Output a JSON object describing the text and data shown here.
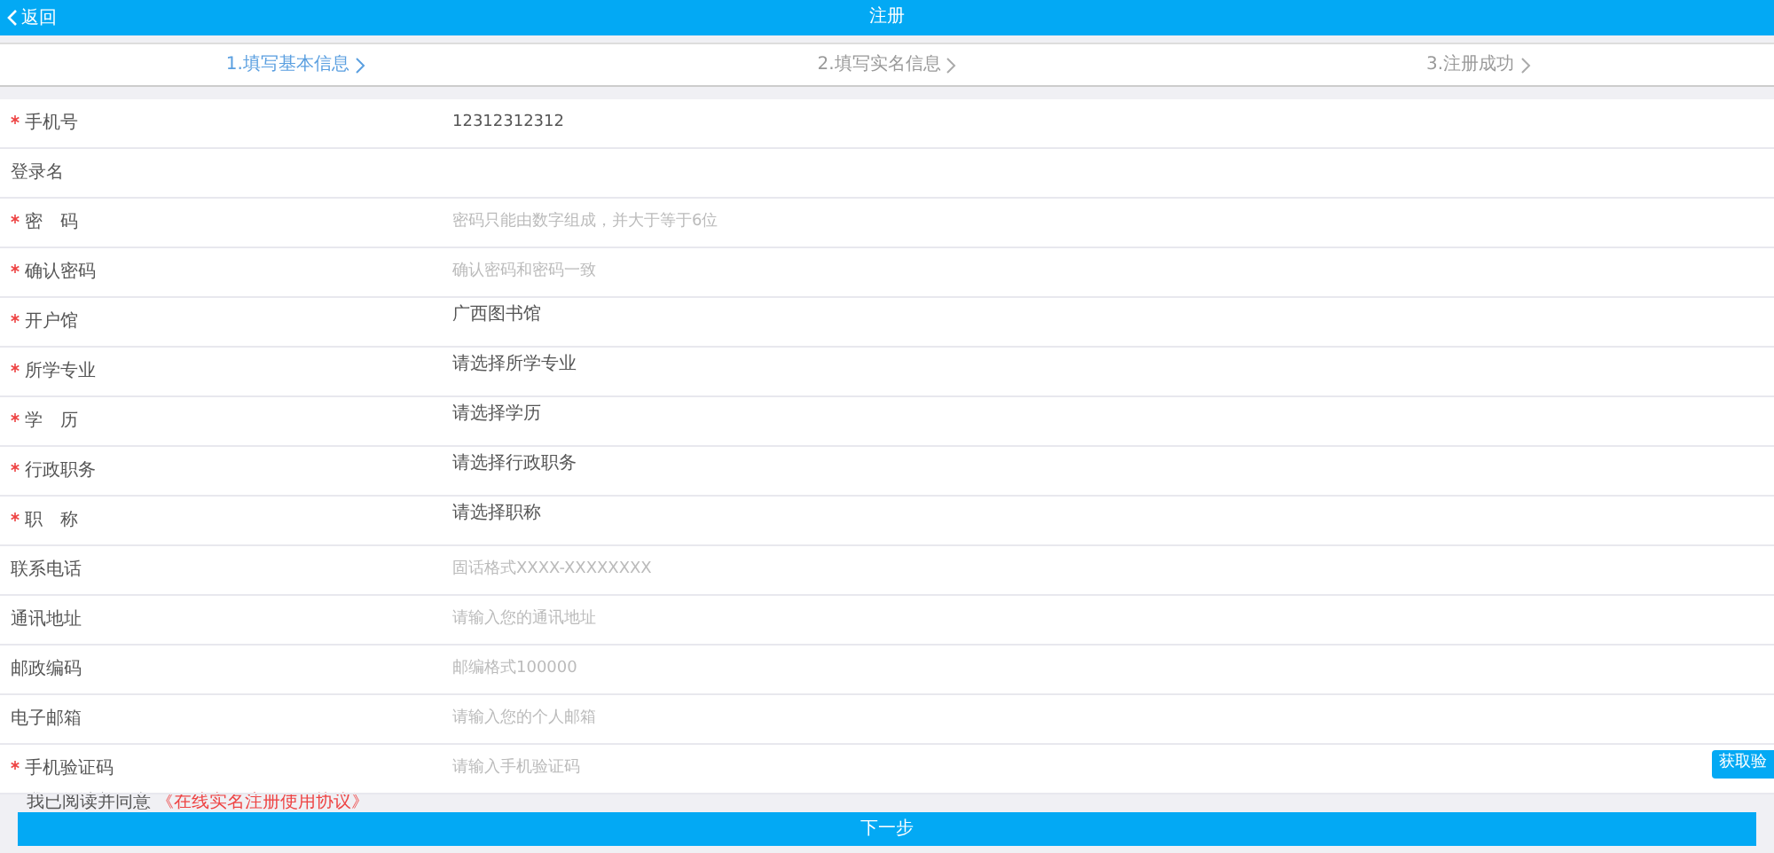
{
  "header": {
    "back": "返回",
    "title": "注册"
  },
  "steps": [
    {
      "label": "1.填写基本信息",
      "selected": true
    },
    {
      "label": "2.填写实名信息",
      "selected": false
    },
    {
      "label": "3.注册成功",
      "selected": false
    }
  ],
  "fields": [
    {
      "label": "手机号",
      "required": true,
      "kind": "input",
      "value": "12312312312"
    },
    {
      "label": "登录名",
      "required": false,
      "kind": "input"
    },
    {
      "label": "密　码",
      "required": true,
      "kind": "input",
      "placeholder": "密码只能由数字组成，并大于等于6位"
    },
    {
      "label": "确认密码",
      "required": true,
      "kind": "input",
      "placeholder": "确认密码和密码一致"
    },
    {
      "label": "开户馆",
      "required": true,
      "kind": "select",
      "value": "广西图书馆"
    },
    {
      "label": "所学专业",
      "required": true,
      "kind": "select",
      "value": "请选择所学专业"
    },
    {
      "label": "学　历",
      "required": true,
      "kind": "select",
      "value": "请选择学历"
    },
    {
      "label": "行政职务",
      "required": true,
      "kind": "select",
      "value": "请选择行政职务"
    },
    {
      "label": "职　称",
      "required": true,
      "kind": "select",
      "value": "请选择职称"
    },
    {
      "label": "联系电话",
      "required": false,
      "kind": "input",
      "placeholder": "固话格式XXXX-XXXXXXXX"
    },
    {
      "label": "通讯地址",
      "required": false,
      "kind": "input",
      "placeholder": "请输入您的通讯地址"
    },
    {
      "label": "邮政编码",
      "required": false,
      "kind": "input",
      "placeholder": "邮编格式100000"
    },
    {
      "label": "电子邮箱",
      "required": false,
      "kind": "input",
      "placeholder": "请输入您的个人邮箱"
    },
    {
      "label": "手机验证码",
      "required": true,
      "kind": "input",
      "placeholder": "请输入手机验证码",
      "button": "获取验"
    }
  ],
  "agreement": {
    "text": "我已阅读并同意",
    "link": "《在线实名注册使用协议》"
  },
  "next_button": "下一步"
}
